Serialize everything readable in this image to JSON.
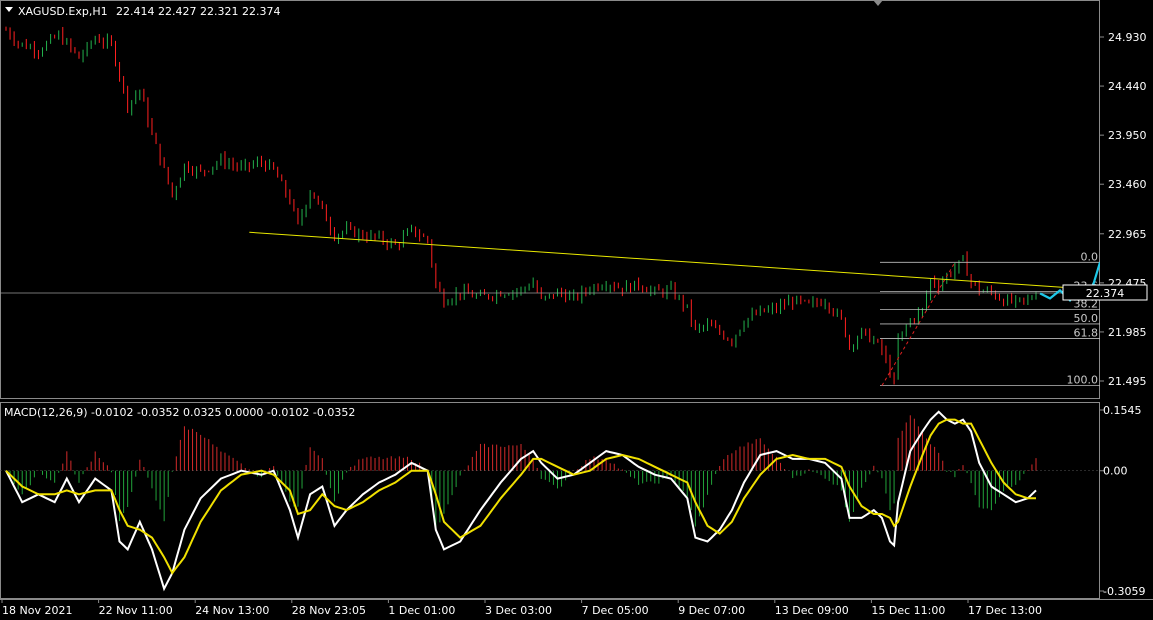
{
  "header": {
    "symbol": "XAGUSD.Exp,H1",
    "ohlc": "22.414 22.427 22.321 22.374"
  },
  "macd_header": "MACD(12,26,9) -0.0102 -0.0352 0.0325 0.0000 -0.0102 -0.0352",
  "current_price": "22.374",
  "chart_data": [
    {
      "type": "candlestick",
      "title": "XAGUSD.Exp,H1",
      "ylim": [
        21.4,
        25.2
      ],
      "y_ticks": [
        "24.930",
        "24.440",
        "23.950",
        "23.460",
        "22.965",
        "22.475",
        "21.985",
        "21.495"
      ],
      "x_ticks": [
        "18 Nov 2021",
        "22 Nov 11:00",
        "24 Nov 13:00",
        "28 Nov 23:05",
        "1 Dec 01:00",
        "3 Dec 03:00",
        "7 Dec 05:00",
        "9 Dec 07:00",
        "13 Dec 09:00",
        "15 Dec 11:00",
        "17 Dec 13:00"
      ],
      "bull_color": "#22b14c",
      "bear_color": "#ff2020",
      "anchors": [
        [
          0,
          25.0
        ],
        [
          3,
          24.87
        ],
        [
          8,
          24.8
        ],
        [
          13,
          24.95
        ],
        [
          18,
          24.72
        ],
        [
          22,
          24.92
        ],
        [
          26,
          24.85
        ],
        [
          30,
          24.25
        ],
        [
          33,
          24.4
        ],
        [
          36,
          23.95
        ],
        [
          39,
          23.6
        ],
        [
          41,
          23.35
        ],
        [
          44,
          23.65
        ],
        [
          48,
          23.58
        ],
        [
          53,
          23.7
        ],
        [
          58,
          23.62
        ],
        [
          63,
          23.68
        ],
        [
          66,
          23.6
        ],
        [
          70,
          23.3
        ],
        [
          72,
          23.05
        ],
        [
          75,
          23.4
        ],
        [
          78,
          23.2
        ],
        [
          81,
          22.95
        ],
        [
          84,
          23.0
        ],
        [
          88,
          22.95
        ],
        [
          92,
          22.92
        ],
        [
          96,
          22.85
        ],
        [
          100,
          23.0
        ],
        [
          104,
          22.9
        ],
        [
          106,
          22.45
        ],
        [
          108,
          22.3
        ],
        [
          112,
          22.38
        ],
        [
          117,
          22.33
        ],
        [
          122,
          22.38
        ],
        [
          127,
          22.4
        ],
        [
          130,
          22.48
        ],
        [
          132,
          22.3
        ],
        [
          136,
          22.38
        ],
        [
          140,
          22.32
        ],
        [
          144,
          22.42
        ],
        [
          148,
          22.48
        ],
        [
          152,
          22.42
        ],
        [
          156,
          22.46
        ],
        [
          160,
          22.38
        ],
        [
          164,
          22.4
        ],
        [
          168,
          22.22
        ],
        [
          170,
          22.0
        ],
        [
          173,
          22.05
        ],
        [
          176,
          21.98
        ],
        [
          179,
          21.9
        ],
        [
          182,
          22.1
        ],
        [
          186,
          22.18
        ],
        [
          190,
          22.22
        ],
        [
          194,
          22.3
        ],
        [
          198,
          22.25
        ],
        [
          202,
          22.3
        ],
        [
          206,
          22.1
        ],
        [
          208,
          21.85
        ],
        [
          211,
          21.98
        ],
        [
          214,
          21.9
        ],
        [
          216,
          21.8
        ],
        [
          218,
          21.58
        ],
        [
          219,
          21.48
        ],
        [
          220,
          21.9
        ],
        [
          223,
          22.1
        ],
        [
          226,
          22.2
        ],
        [
          228,
          22.5
        ],
        [
          230,
          22.45
        ],
        [
          232,
          22.55
        ],
        [
          234,
          22.62
        ],
        [
          236,
          22.7
        ],
        [
          238,
          22.48
        ],
        [
          240,
          22.4
        ],
        [
          243,
          22.38
        ],
        [
          246,
          22.3
        ],
        [
          249,
          22.28
        ],
        [
          252,
          22.3
        ],
        [
          254,
          22.37
        ]
      ],
      "trendline": {
        "from": [
          60,
          22.98
        ],
        "to": [
          234,
          22.39
        ],
        "color": "#e8e800"
      },
      "fibonacci": {
        "levels": [
          "0.0",
          "23.6",
          "38.2",
          "50.0",
          "61.8",
          "100.0"
        ],
        "high": 22.68,
        "low": 21.45,
        "color": "#bdbdbd"
      },
      "forecast_path": [
        [
          22.37
        ],
        [
          22.32
        ],
        [
          22.4
        ],
        [
          22.3
        ],
        [
          22.42
        ],
        [
          22.35
        ],
        [
          22.68
        ]
      ],
      "forecast_color": "#1ec8e8",
      "current_price": 22.374
    },
    {
      "type": "line",
      "title": "MACD(12,26,9)",
      "ylim": [
        -0.34,
        0.17
      ],
      "y_ticks": [
        "0.1545",
        "0.00",
        "-0.3059"
      ],
      "series": [
        {
          "color": "#ffffff",
          "values_anchor": [
            [
              0,
              0.0
            ],
            [
              4,
              -0.08
            ],
            [
              8,
              -0.06
            ],
            [
              12,
              -0.08
            ],
            [
              15,
              -0.02
            ],
            [
              18,
              -0.08
            ],
            [
              22,
              -0.02
            ],
            [
              26,
              -0.05
            ],
            [
              28,
              -0.18
            ],
            [
              30,
              -0.2
            ],
            [
              33,
              -0.13
            ],
            [
              36,
              -0.2
            ],
            [
              39,
              -0.3
            ],
            [
              41,
              -0.26
            ],
            [
              44,
              -0.15
            ],
            [
              48,
              -0.07
            ],
            [
              53,
              -0.02
            ],
            [
              58,
              0.0
            ],
            [
              63,
              -0.01
            ],
            [
              66,
              0.0
            ],
            [
              70,
              -0.1
            ],
            [
              72,
              -0.17
            ],
            [
              75,
              -0.06
            ],
            [
              78,
              -0.04
            ],
            [
              81,
              -0.14
            ],
            [
              84,
              -0.1
            ],
            [
              88,
              -0.06
            ],
            [
              92,
              -0.03
            ],
            [
              96,
              -0.01
            ],
            [
              100,
              0.02
            ],
            [
              104,
              0.0
            ],
            [
              106,
              -0.15
            ],
            [
              108,
              -0.2
            ],
            [
              112,
              -0.18
            ],
            [
              117,
              -0.1
            ],
            [
              122,
              -0.03
            ],
            [
              127,
              0.03
            ],
            [
              130,
              0.05
            ],
            [
              132,
              0.02
            ],
            [
              136,
              -0.02
            ],
            [
              140,
              -0.01
            ],
            [
              144,
              0.02
            ],
            [
              148,
              0.05
            ],
            [
              152,
              0.04
            ],
            [
              156,
              0.01
            ],
            [
              160,
              -0.01
            ],
            [
              164,
              -0.02
            ],
            [
              168,
              -0.07
            ],
            [
              170,
              -0.17
            ],
            [
              173,
              -0.18
            ],
            [
              176,
              -0.15
            ],
            [
              179,
              -0.1
            ],
            [
              182,
              -0.03
            ],
            [
              186,
              0.04
            ],
            [
              190,
              0.05
            ],
            [
              194,
              0.03
            ],
            [
              198,
              0.03
            ],
            [
              202,
              0.02
            ],
            [
              206,
              -0.02
            ],
            [
              208,
              -0.12
            ],
            [
              211,
              -0.12
            ],
            [
              214,
              -0.1
            ],
            [
              216,
              -0.12
            ],
            [
              218,
              -0.18
            ],
            [
              219,
              -0.19
            ],
            [
              220,
              -0.08
            ],
            [
              223,
              0.05
            ],
            [
              226,
              0.1
            ],
            [
              228,
              0.13
            ],
            [
              230,
              0.15
            ],
            [
              232,
              0.13
            ],
            [
              234,
              0.12
            ],
            [
              236,
              0.13
            ],
            [
              238,
              0.1
            ],
            [
              240,
              0.02
            ],
            [
              243,
              -0.04
            ],
            [
              246,
              -0.06
            ],
            [
              249,
              -0.08
            ],
            [
              252,
              -0.07
            ],
            [
              254,
              -0.05
            ]
          ]
        },
        {
          "color": "#f0e000",
          "values_anchor": [
            [
              0,
              0.0
            ],
            [
              4,
              -0.04
            ],
            [
              8,
              -0.06
            ],
            [
              12,
              -0.06
            ],
            [
              15,
              -0.05
            ],
            [
              18,
              -0.06
            ],
            [
              22,
              -0.05
            ],
            [
              26,
              -0.05
            ],
            [
              28,
              -0.1
            ],
            [
              30,
              -0.14
            ],
            [
              33,
              -0.15
            ],
            [
              36,
              -0.17
            ],
            [
              39,
              -0.22
            ],
            [
              41,
              -0.26
            ],
            [
              44,
              -0.22
            ],
            [
              48,
              -0.13
            ],
            [
              53,
              -0.05
            ],
            [
              58,
              -0.01
            ],
            [
              63,
              0.0
            ],
            [
              66,
              -0.01
            ],
            [
              70,
              -0.05
            ],
            [
              72,
              -0.11
            ],
            [
              75,
              -0.1
            ],
            [
              78,
              -0.06
            ],
            [
              81,
              -0.09
            ],
            [
              84,
              -0.1
            ],
            [
              88,
              -0.08
            ],
            [
              92,
              -0.05
            ],
            [
              96,
              -0.03
            ],
            [
              100,
              0.0
            ],
            [
              104,
              0.0
            ],
            [
              106,
              -0.06
            ],
            [
              108,
              -0.13
            ],
            [
              112,
              -0.17
            ],
            [
              117,
              -0.14
            ],
            [
              122,
              -0.07
            ],
            [
              127,
              -0.01
            ],
            [
              130,
              0.03
            ],
            [
              132,
              0.03
            ],
            [
              136,
              0.01
            ],
            [
              140,
              -0.01
            ],
            [
              144,
              0.0
            ],
            [
              148,
              0.03
            ],
            [
              152,
              0.04
            ],
            [
              156,
              0.03
            ],
            [
              160,
              0.01
            ],
            [
              164,
              -0.01
            ],
            [
              168,
              -0.03
            ],
            [
              170,
              -0.08
            ],
            [
              173,
              -0.14
            ],
            [
              176,
              -0.16
            ],
            [
              179,
              -0.13
            ],
            [
              182,
              -0.07
            ],
            [
              186,
              -0.01
            ],
            [
              190,
              0.03
            ],
            [
              194,
              0.04
            ],
            [
              198,
              0.03
            ],
            [
              202,
              0.03
            ],
            [
              206,
              0.01
            ],
            [
              208,
              -0.04
            ],
            [
              211,
              -0.09
            ],
            [
              214,
              -0.11
            ],
            [
              216,
              -0.11
            ],
            [
              218,
              -0.12
            ],
            [
              219,
              -0.14
            ],
            [
              220,
              -0.13
            ],
            [
              223,
              -0.04
            ],
            [
              226,
              0.04
            ],
            [
              228,
              0.09
            ],
            [
              230,
              0.12
            ],
            [
              232,
              0.13
            ],
            [
              234,
              0.13
            ],
            [
              236,
              0.12
            ],
            [
              238,
              0.12
            ],
            [
              240,
              0.08
            ],
            [
              243,
              0.02
            ],
            [
              246,
              -0.03
            ],
            [
              249,
              -0.06
            ],
            [
              252,
              -0.07
            ],
            [
              254,
              -0.07
            ]
          ]
        }
      ]
    }
  ]
}
